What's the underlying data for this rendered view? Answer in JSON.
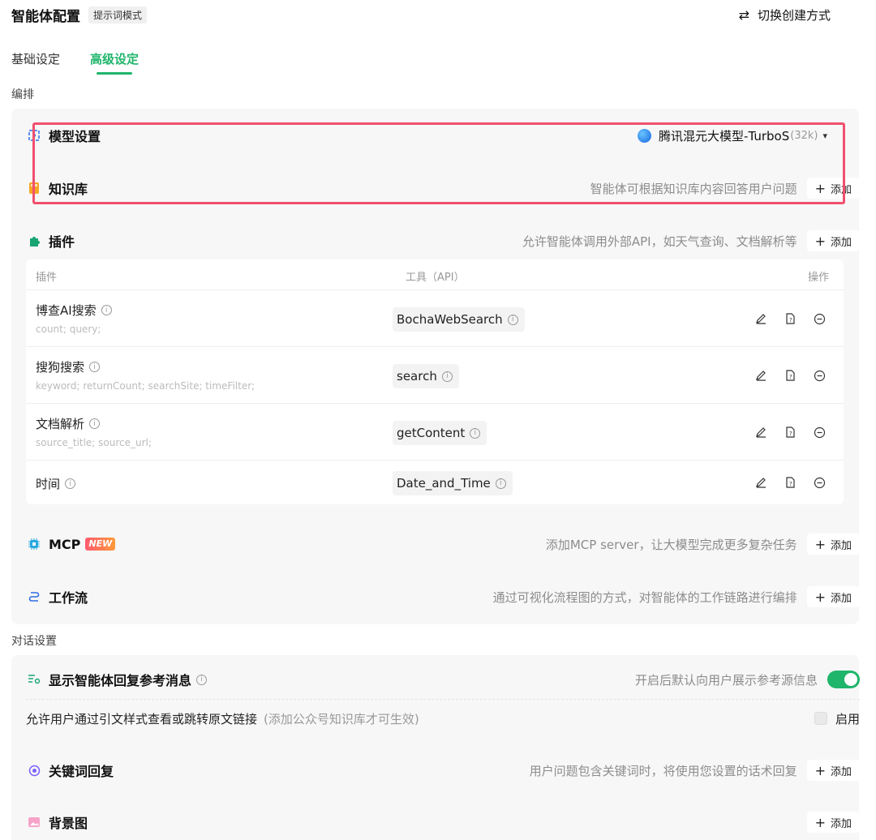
{
  "header": {
    "title": "智能体配置",
    "mode_badge": "提示词模式",
    "switch_label": "切换创建方式"
  },
  "tabs": [
    {
      "label": "基础设定"
    },
    {
      "label": "高级设定"
    }
  ],
  "sections": {
    "arrange": "编排",
    "dialog": "对话设置"
  },
  "model": {
    "name": "模型设置",
    "selected": "腾讯混元大模型-TurboS",
    "context": "(32k)"
  },
  "knowledge": {
    "name": "知识库",
    "desc": "智能体可根据知识库内容回答用户问题",
    "add": "添加"
  },
  "plugins": {
    "name": "插件",
    "desc": "允许智能体调用外部API，如天气查询、文档解析等",
    "add": "添加",
    "columns": [
      "插件",
      "工具（API）",
      "操作"
    ],
    "rows": [
      {
        "name": "博查AI搜索",
        "params": "count; query;",
        "tool": "BochaWebSearch"
      },
      {
        "name": "搜狗搜索",
        "params": "keyword; returnCount; searchSite; timeFilter;",
        "tool": "search"
      },
      {
        "name": "文档解析",
        "params": "source_title; source_url;",
        "tool": "getContent"
      },
      {
        "name": "时间",
        "params": "",
        "tool": "Date_and_Time"
      }
    ]
  },
  "mcp": {
    "name": "MCP",
    "badge": "NEW",
    "desc": "添加MCP server，让大模型完成更多复杂任务",
    "add": "添加"
  },
  "workflow": {
    "name": "工作流",
    "desc": "通过可视化流程图的方式，对智能体的工作链路进行编排",
    "add": "添加"
  },
  "reference": {
    "name": "显示智能体回复参考消息",
    "desc": "开启后默认向用户展示参考源信息",
    "toggle_on": true,
    "sub_text": "允许用户通过引文样式查看或跳转原文链接",
    "sub_note": "(添加公众号知识库才可生效)",
    "sub_check_label": "启用"
  },
  "keyword": {
    "name": "关键词回复",
    "desc": "用户问题包含关键词时，将使用您设置的话术回复",
    "add": "添加"
  },
  "background": {
    "name": "背景图",
    "add": "添加"
  },
  "colors": {
    "accent": "#1fb56b",
    "highlight": "#f0506e"
  }
}
